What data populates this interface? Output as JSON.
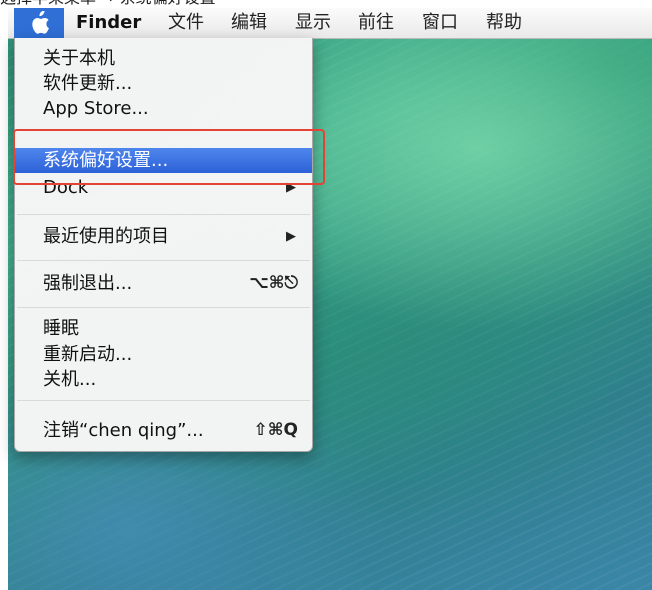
{
  "caption": "选择苹果菜单 → 系统偏好设置",
  "colors": {
    "accent": "#2f6fd6",
    "selection": "#3a6fe0",
    "annotation": "#e34234"
  },
  "menubar": {
    "apple_icon": "apple-logo-icon",
    "items": [
      "Finder",
      "文件",
      "编辑",
      "显示",
      "前往",
      "窗口",
      "帮助"
    ]
  },
  "apple_menu": {
    "about": "关于本机",
    "software_update": "软件更新...",
    "app_store": "App Store...",
    "system_prefs": "系统偏好设置...",
    "dock": "Dock",
    "recent_items": "最近使用的项目",
    "force_quit": "强制退出...",
    "force_quit_shortcut": "⌥⌘⎋",
    "sleep": "睡眠",
    "restart": "重新启动...",
    "shutdown": "关机...",
    "logout": "注销“chen qing”...",
    "logout_shortcut": "⇧⌘Q",
    "submenu_arrow": "▶"
  }
}
